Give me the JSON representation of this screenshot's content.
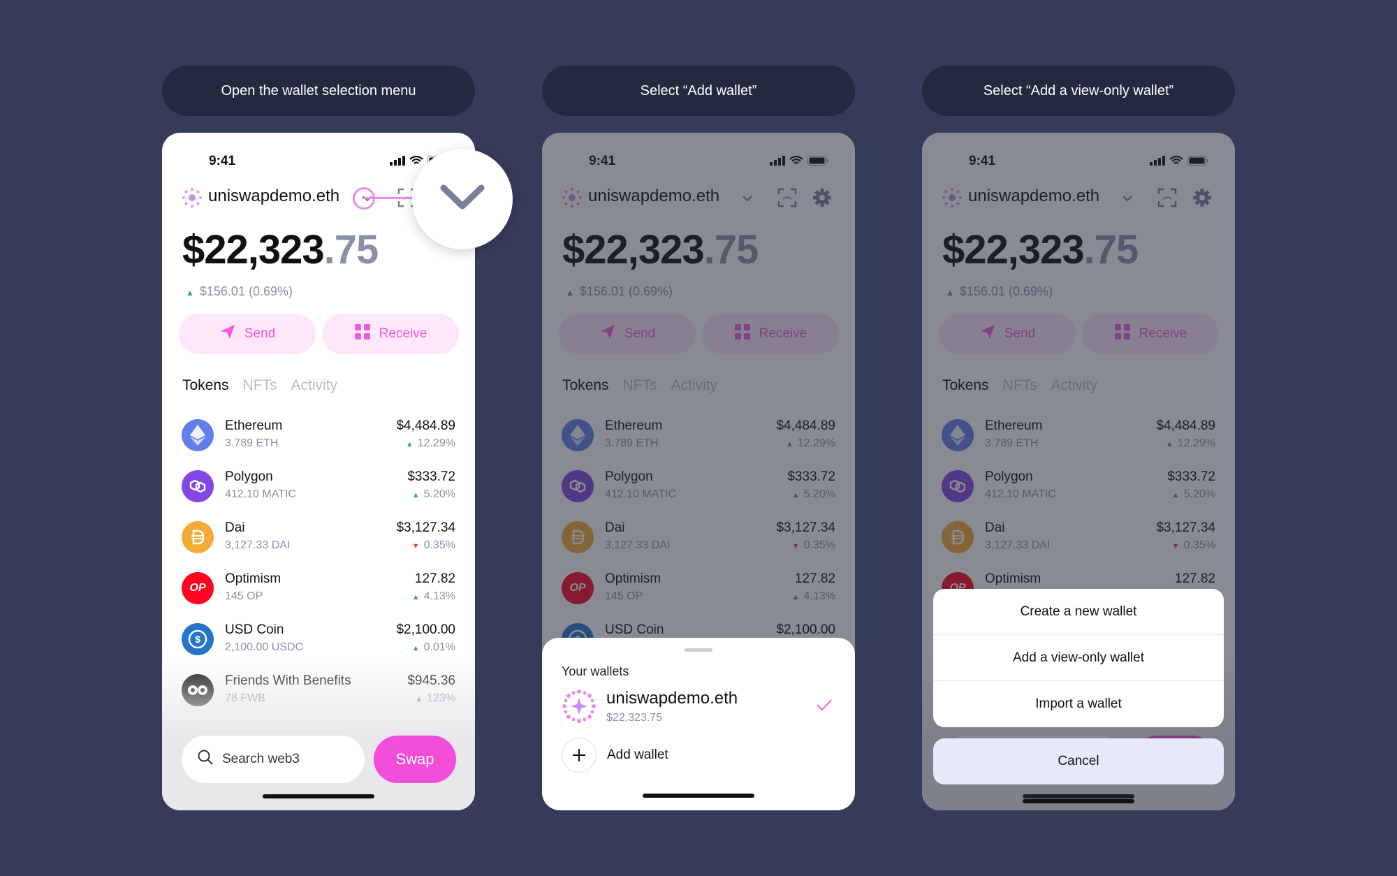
{
  "steps": [
    {
      "label": "Open the wallet selection menu"
    },
    {
      "label": "Select “Add wallet”"
    },
    {
      "label": "Select “Add a view-only wallet”"
    }
  ],
  "phone": {
    "time": "9:41",
    "account": "uniswapdemo.eth",
    "balance_main": "$22,323",
    "balance_cents": ".75",
    "delta": "$156.01 (0.69%)",
    "send_label": "Send",
    "receive_label": "Receive",
    "tabs": [
      "Tokens",
      "NFTs",
      "Activity"
    ],
    "tokens": [
      {
        "name": "Ethereum",
        "amount": "3.789 ETH",
        "value": "$4,484.89",
        "change": "12.29%",
        "dir": "up",
        "color": "#627eea",
        "icon": "eth-icon"
      },
      {
        "name": "Polygon",
        "amount": "412.10 MATIC",
        "value": "$333.72",
        "change": "5.20%",
        "dir": "up",
        "color": "#8247e5",
        "icon": "polygon-icon"
      },
      {
        "name": "Dai",
        "amount": "3,127.33 DAI",
        "value": "$3,127.34",
        "change": "0.35%",
        "dir": "down",
        "color": "#f5ac37",
        "icon": "dai-icon"
      },
      {
        "name": "Optimism",
        "amount": "145 OP",
        "value": "127.82",
        "change": "4.13%",
        "dir": "up",
        "color": "#ff0420",
        "icon": "op-icon"
      },
      {
        "name": "USD Coin",
        "amount": "2,100.00 USDC",
        "value": "$2,100.00",
        "change": "0.01%",
        "dir": "up",
        "color": "#2775ca",
        "icon": "usdc-icon"
      },
      {
        "name": "Friends With Benefits",
        "amount": "78 FWB",
        "value": "$945.36",
        "change": "123%",
        "dir": "up",
        "color": "#111111",
        "icon": "fwb-icon"
      }
    ],
    "op_glyph": "OP",
    "search_placeholder": "Search web3",
    "swap_label": "Swap"
  },
  "wallet_sheet": {
    "title": "Your wallets",
    "wallet_name": "uniswapdemo.eth",
    "wallet_balance": "$22,323.75",
    "add_label": "Add wallet"
  },
  "action_sheet": {
    "items": [
      "Create a new wallet",
      "Add a view-only wallet",
      "Import a wallet"
    ],
    "cancel": "Cancel"
  },
  "colors": {
    "background": "#343c5a",
    "accent": "#f24ed9",
    "pill_bg": "#fde7f8"
  }
}
